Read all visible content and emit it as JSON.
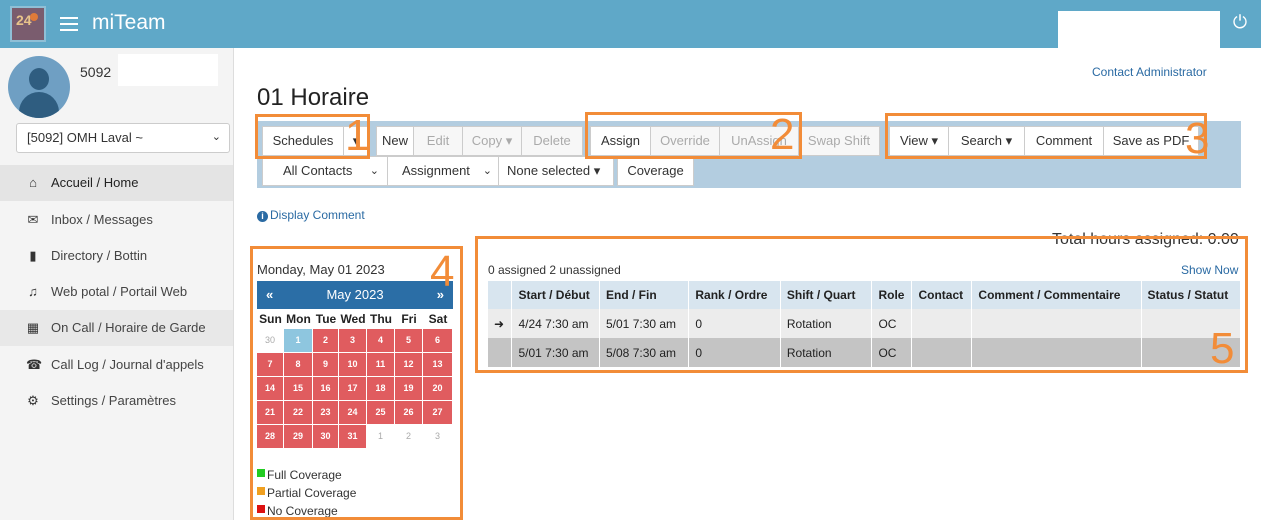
{
  "header": {
    "app_title": "miTeam",
    "logo_text": "24",
    "menu_icon": "hamburger-icon",
    "power_icon": "power-icon"
  },
  "sidebar": {
    "user_id": "5092",
    "org_select": "[5092] OMH Laval ~",
    "items": [
      {
        "label": "Accueil / Home",
        "icon": "home-icon"
      },
      {
        "label": "Inbox / Messages",
        "icon": "envelope-icon"
      },
      {
        "label": "Directory / Bottin",
        "icon": "book-icon"
      },
      {
        "label": "Web potal / Portail Web",
        "icon": "music-icon"
      },
      {
        "label": "On Call / Horaire de Garde",
        "icon": "calendar-icon"
      },
      {
        "label": "Call Log / Journal d'appels",
        "icon": "phone-icon"
      },
      {
        "label": "Settings / Paramètres",
        "icon": "gear-icon"
      }
    ]
  },
  "main": {
    "contact_admin": "Contact Administrator",
    "page_title": "01 Horaire",
    "toolbar": {
      "schedules": "Schedules",
      "new": "New",
      "edit": "Edit",
      "copy": "Copy ▾",
      "delete": "Delete",
      "assign": "Assign",
      "override": "Override",
      "unassign": "UnAssign",
      "swap_shift": "Swap Shift",
      "view": "View ▾",
      "search": "Search ▾",
      "comment": "Comment",
      "save_pdf": "Save as PDF",
      "all_contacts": "All Contacts",
      "assignment": "Assignment",
      "none_selected": "None selected ▾",
      "coverage": "Coverage"
    },
    "display_comment": "Display Comment",
    "date_label": "Monday, May 01 2023"
  },
  "calendar": {
    "month": "May 2023",
    "prev": "«",
    "next": "»",
    "weekdays": [
      "Sun",
      "Mon",
      "Tue",
      "Wed",
      "Thu",
      "Fri",
      "Sat"
    ],
    "weeks": [
      [
        {
          "d": "30",
          "s": "other"
        },
        {
          "d": "1",
          "s": "blue"
        },
        {
          "d": "2",
          "s": "red"
        },
        {
          "d": "3",
          "s": "red"
        },
        {
          "d": "4",
          "s": "red"
        },
        {
          "d": "5",
          "s": "red"
        },
        {
          "d": "6",
          "s": "red"
        }
      ],
      [
        {
          "d": "7",
          "s": "red"
        },
        {
          "d": "8",
          "s": "red"
        },
        {
          "d": "9",
          "s": "red"
        },
        {
          "d": "10",
          "s": "red"
        },
        {
          "d": "11",
          "s": "red"
        },
        {
          "d": "12",
          "s": "red"
        },
        {
          "d": "13",
          "s": "red"
        }
      ],
      [
        {
          "d": "14",
          "s": "red"
        },
        {
          "d": "15",
          "s": "red"
        },
        {
          "d": "16",
          "s": "red"
        },
        {
          "d": "17",
          "s": "red"
        },
        {
          "d": "18",
          "s": "red"
        },
        {
          "d": "19",
          "s": "red"
        },
        {
          "d": "20",
          "s": "red"
        }
      ],
      [
        {
          "d": "21",
          "s": "red"
        },
        {
          "d": "22",
          "s": "red"
        },
        {
          "d": "23",
          "s": "red"
        },
        {
          "d": "24",
          "s": "red"
        },
        {
          "d": "25",
          "s": "red"
        },
        {
          "d": "26",
          "s": "red"
        },
        {
          "d": "27",
          "s": "red"
        }
      ],
      [
        {
          "d": "28",
          "s": "red"
        },
        {
          "d": "29",
          "s": "red"
        },
        {
          "d": "30",
          "s": "red"
        },
        {
          "d": "31",
          "s": "red"
        },
        {
          "d": "1",
          "s": "other"
        },
        {
          "d": "2",
          "s": "other"
        },
        {
          "d": "3",
          "s": "other"
        }
      ]
    ],
    "legend": [
      {
        "label": "Full Coverage",
        "color": "#22cc22"
      },
      {
        "label": "Partial Coverage",
        "color": "#f0a020"
      },
      {
        "label": "No Coverage",
        "color": "#dd1111"
      }
    ]
  },
  "schedule": {
    "total_hours": "Total hours assigned: 0.00",
    "counts": "0 assigned 2 unassigned",
    "show_now": "Show Now",
    "columns": [
      "",
      "Start / Début",
      "End / Fin",
      "Rank / Ordre",
      "Shift / Quart",
      "Role",
      "Contact",
      "Comment / Commentaire",
      "Status / Statut"
    ],
    "rows": [
      {
        "marker": "➜",
        "start": "4/24 7:30 am",
        "end": "5/01 7:30 am",
        "rank": "0",
        "shift": "Rotation",
        "role": "OC",
        "contact": "",
        "comment": "",
        "status": ""
      },
      {
        "marker": "",
        "start": "5/01 7:30 am",
        "end": "5/08 7:30 am",
        "rank": "0",
        "shift": "Rotation",
        "role": "OC",
        "contact": "",
        "comment": "",
        "status": ""
      }
    ]
  },
  "annotations": [
    "1",
    "2",
    "3",
    "4",
    "5"
  ],
  "colors": {
    "topbar": "#5fa8c8",
    "toolbar": "#b3cde0",
    "calendar_header": "#2b6ea6",
    "no_coverage_day": "#e05c5f",
    "selected_day": "#8ec6df",
    "annotation": "#f28c38",
    "link": "#2a6aa3"
  }
}
